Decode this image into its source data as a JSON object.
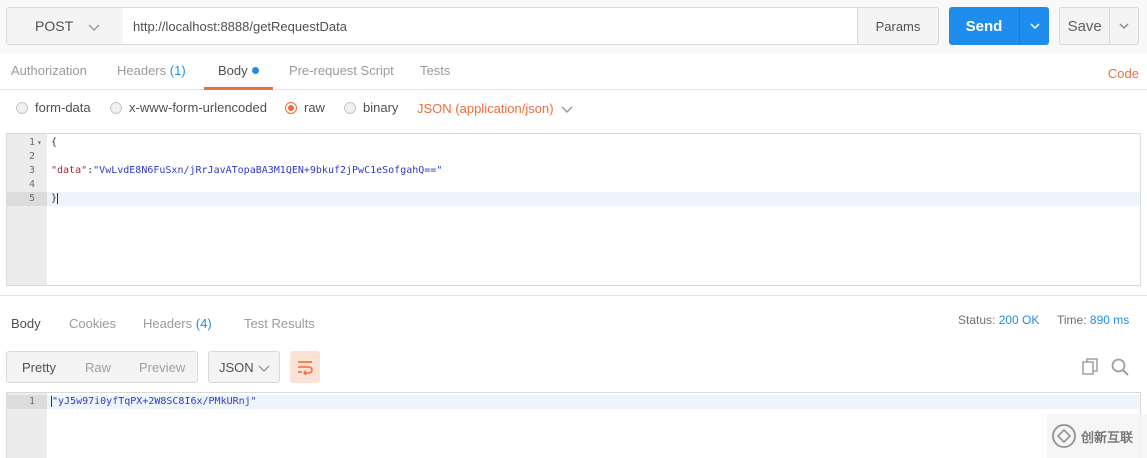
{
  "request": {
    "method": "POST",
    "url": "http://localhost:8888/getRequestData",
    "params_label": "Params",
    "send_label": "Send",
    "save_label": "Save"
  },
  "request_tabs": {
    "authorization": "Authorization",
    "headers": "Headers",
    "headers_count": "(1)",
    "body": "Body",
    "prerequest": "Pre-request Script",
    "tests": "Tests",
    "code": "Code"
  },
  "body_types": {
    "form_data": "form-data",
    "urlencoded": "x-www-form-urlencoded",
    "raw": "raw",
    "binary": "binary",
    "selected": "raw",
    "content_type": "JSON (application/json)"
  },
  "request_editor": {
    "lines": [
      {
        "num": "1",
        "text": "{"
      },
      {
        "num": "2",
        "text": ""
      },
      {
        "num": "3",
        "key": "\"data\"",
        "sep": ":",
        "value": "\"VwLvdE8N6FuSxn/jRrJavATopaBA3M1QEN+9bkuf2jPwC1eSofgahQ==\""
      },
      {
        "num": "4",
        "text": ""
      },
      {
        "num": "5",
        "text": "}"
      }
    ]
  },
  "response_tabs": {
    "body": "Body",
    "cookies": "Cookies",
    "headers": "Headers",
    "headers_count": "(4)",
    "test_results": "Test Results",
    "status_label": "Status:",
    "status_value": "200 OK",
    "time_label": "Time:",
    "time_value": "890 ms"
  },
  "response_toolbar": {
    "pretty": "Pretty",
    "raw": "Raw",
    "preview": "Preview",
    "format": "JSON"
  },
  "response_editor": {
    "lines": [
      {
        "num": "1",
        "value": "\"yJ5w97i0yfTqPX+2W8SC8I6x/PMkURnj\""
      }
    ]
  },
  "watermark": {
    "text": "创新互联"
  },
  "colors": {
    "accent_orange": "#f26b3a",
    "accent_blue": "#1f8ded"
  }
}
